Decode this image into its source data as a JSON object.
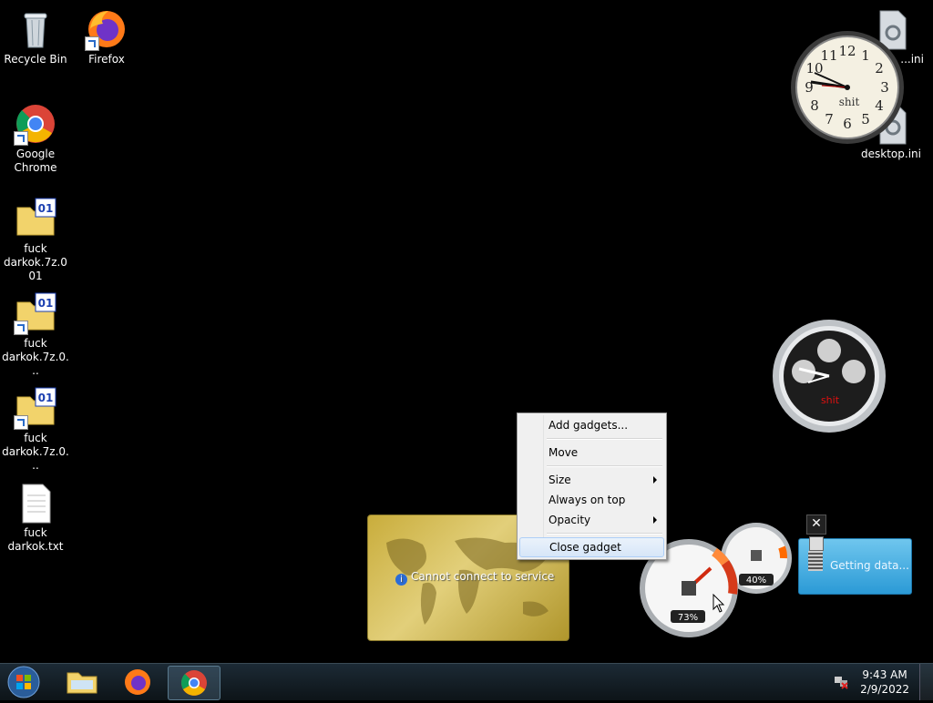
{
  "desktop_icons": {
    "recycle_bin": "Recycle Bin",
    "firefox": "Firefox",
    "chrome": "Google Chrome",
    "archive1": "fuck darkok.7z.001",
    "archive2": "fuck darkok.7z.0...",
    "archive3": "fuck darkok.7z.0...",
    "textfile": "fuck darkok.txt",
    "ini_top": "...ini",
    "ini_bottom": "desktop.ini"
  },
  "clock_gadget": {
    "label": "shit",
    "numbers": [
      "12",
      "1",
      "2",
      "3",
      "4",
      "5",
      "6",
      "7",
      "8",
      "9",
      "10",
      "11"
    ]
  },
  "chrono_gadget": {
    "label": "shit"
  },
  "weather_gadget": {
    "status": "Cannot connect to service"
  },
  "cpu_gadget": {
    "cpu_percent": "73%",
    "mem_percent": "40%"
  },
  "feed_gadget": {
    "status": "Getting data..."
  },
  "context_menu": {
    "add": "Add gadgets...",
    "move": "Move",
    "size": "Size",
    "always_on_top": "Always on top",
    "opacity": "Opacity",
    "close": "Close gadget"
  },
  "taskbar": {
    "time": "9:43 AM",
    "date": "2/9/2022"
  },
  "colors": {
    "taskbar": "#1c2a35",
    "menu_bg": "#f0f0f0",
    "highlight": "#d7e6f8"
  }
}
